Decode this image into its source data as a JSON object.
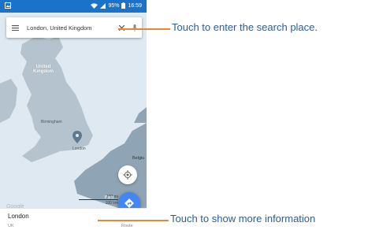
{
  "status_bar": {
    "battery": "95%",
    "time": "16:59"
  },
  "search": {
    "query": "London, United Kingdom"
  },
  "map": {
    "labels": {
      "united_kingdom": "United\nKingdom",
      "birmingham": "Birmingham",
      "london": "London",
      "belgium": "Belgiu",
      "paris": "Paris"
    },
    "watermark": "Google",
    "scale_mi": "100 mi",
    "scale_km": "100 km"
  },
  "place": {
    "name": "London",
    "subtitle": "UK",
    "route_label": "Route"
  },
  "callouts": {
    "search": "Touch to enter the search place.",
    "more_info": "Touch to show more information"
  },
  "colors": {
    "status_bar": "#1a73c9",
    "accent": "#4285f4",
    "callout_text": "#2a5d9f",
    "callout_line": "#e8863a"
  }
}
